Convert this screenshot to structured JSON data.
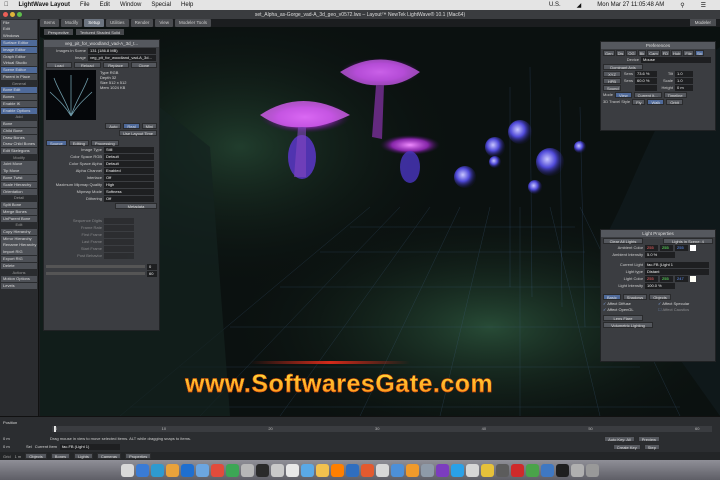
{
  "menubar": {
    "app_name": "LightWave Layout",
    "items": [
      "File",
      "Edit",
      "Window",
      "Special",
      "Help"
    ],
    "clock": "Mon Mar 27 11:05:48 AM",
    "locale": "U.S."
  },
  "window": {
    "title": "set_Alpha_as-Gorge_vad-A_3d_geo_v0572.lws – Layout™ NewTek LightWave® 10.1 (Mac64)"
  },
  "layout_tabs": [
    {
      "label": "Items",
      "active": false
    },
    {
      "label": "Modify",
      "active": false
    },
    {
      "label": "Setup",
      "active": true
    },
    {
      "label": "Utilities",
      "active": false
    },
    {
      "label": "Render",
      "active": false
    },
    {
      "label": "View",
      "active": false
    },
    {
      "label": "Modeler Tools",
      "active": false
    }
  ],
  "modeler_button": "Modeler",
  "sidebar": {
    "items": [
      {
        "label": "File",
        "type": "item"
      },
      {
        "label": "Edit",
        "type": "item"
      },
      {
        "label": "Windows",
        "type": "item"
      },
      {
        "label": "Surface Editor",
        "type": "hl"
      },
      {
        "label": "Image Editor",
        "type": "hl"
      },
      {
        "label": "Graph Editor",
        "type": "item"
      },
      {
        "label": "Virtual Studio",
        "type": "item"
      },
      {
        "label": "Scene Editor",
        "type": "hl"
      },
      {
        "label": "Parent in Place",
        "type": "item"
      },
      {
        "label": "General",
        "type": "head"
      },
      {
        "label": "Bone Edit",
        "type": "hl"
      },
      {
        "label": "Bones",
        "type": "item"
      },
      {
        "label": "Enable IK",
        "type": "item"
      },
      {
        "label": "Enable Options",
        "type": "hl"
      },
      {
        "label": "Add",
        "type": "head"
      },
      {
        "label": "Bone",
        "type": "item"
      },
      {
        "label": "Child Bone",
        "type": "item"
      },
      {
        "label": "Draw Bones",
        "type": "item"
      },
      {
        "label": "Draw Child Bones",
        "type": "item"
      },
      {
        "label": "Edit Skelegons",
        "type": "item"
      },
      {
        "label": "Modify",
        "type": "head"
      },
      {
        "label": "Joint Move",
        "type": "item"
      },
      {
        "label": "Tip Move",
        "type": "item"
      },
      {
        "label": "Bone Twist",
        "type": "item"
      },
      {
        "label": "Scale Hierarchy",
        "type": "item"
      },
      {
        "label": "Orientation",
        "type": "item"
      },
      {
        "label": "Detail",
        "type": "head"
      },
      {
        "label": "Split Bone",
        "type": "item"
      },
      {
        "label": "Merge Bones",
        "type": "item"
      },
      {
        "label": "UnParent Bone",
        "type": "item"
      },
      {
        "label": "Edit",
        "type": "head"
      },
      {
        "label": "Copy Hierarchy",
        "type": "item"
      },
      {
        "label": "Mirror Hierarchy",
        "type": "item"
      },
      {
        "label": "Rename Hierarchy",
        "type": "item"
      },
      {
        "label": "Import RIG",
        "type": "item"
      },
      {
        "label": "Export RIG",
        "type": "item"
      },
      {
        "label": "Delete",
        "type": "item"
      },
      {
        "label": "Actions",
        "type": "head"
      },
      {
        "label": "Motion Options",
        "type": "item"
      },
      {
        "label": "Levels",
        "type": "item"
      }
    ]
  },
  "viewport": {
    "view_mode": "Perspective",
    "shading": "Textured Shaded Solid"
  },
  "image_editor": {
    "title": "veg_pit_for_woodland_vad-A_3d_t...",
    "images_in_scene_label": "Images in Scene",
    "images_in_scene_value": "131 (186.8 MB)",
    "image_label": "Image",
    "image_value": "veg_pit_for_woodland_vad-A_3d...",
    "buttons": [
      "Load",
      "Reload",
      "Replace",
      "Clone"
    ],
    "info": [
      {
        "k": "Type",
        "v": "RGB"
      },
      {
        "k": "Depth",
        "v": "32"
      },
      {
        "k": "Size",
        "v": "512 x 512"
      },
      {
        "k": "Mem",
        "v": "1024 KB"
      }
    ],
    "view_buttons": [
      "Auto",
      "Real",
      "Mini"
    ],
    "use_layout_time": "Use Layout Time",
    "tabs": [
      "Source",
      "Editing",
      "Processing"
    ],
    "fields": [
      {
        "k": "Image Type",
        "v": "Still"
      },
      {
        "k": "Color Space RGB",
        "v": "Default"
      },
      {
        "k": "Color Space Alpha",
        "v": "Default"
      },
      {
        "k": "Alpha Channel",
        "v": "Enabled"
      },
      {
        "k": "Interlace",
        "v": "Off"
      },
      {
        "k": "Maximum Mipmap Quality",
        "v": "High"
      },
      {
        "k": "Mipmap Mode",
        "v": "Softness"
      },
      {
        "k": "Dithering",
        "v": "Off"
      }
    ],
    "metadata_button": "Metadata",
    "sequence_fields": [
      "Sequence Digits",
      "Frame Rate",
      "First Frame",
      "Last Frame",
      "Start Frame",
      "Post Behavior"
    ],
    "field_values": [
      "0",
      "60"
    ]
  },
  "preferences": {
    "title": "Preferences",
    "tabs": [
      "Gen",
      "Dis",
      "OG",
      "Bk",
      "Cam",
      "FD",
      "Hub",
      "File",
      "Ski"
    ],
    "device_label": "Device",
    "device_value": "Mouse",
    "dominant_axis": "Dominant Axis",
    "rows": [
      {
        "k": "XYZ",
        "v1": "Sens",
        "v2": "73.6 %",
        "v3": "Tilt",
        "v4": "1.0"
      },
      {
        "k": "HPB",
        "v1": "Sens",
        "v2": "60.0 %",
        "v3": "Scale",
        "v4": "1.0"
      },
      {
        "k": "Sound",
        "v1": "",
        "v2": "",
        "v3": "Height",
        "v4": "0 m"
      }
    ],
    "mode_row": [
      "Mode",
      "View",
      "Current It...",
      "Timeline"
    ],
    "travel_row": [
      "3D Travel Style",
      "Fly",
      "Walk",
      "Orbit"
    ]
  },
  "light_properties": {
    "title": "Light Properties",
    "clear_lights": "Clear All Lights",
    "lights_in_scene": "Lights in Scene: 4",
    "ambient_color_label": "Ambient Color",
    "ambient_color_rgb": [
      "255",
      "255",
      "255"
    ],
    "ambient_intensity_label": "Ambient Intensity",
    "ambient_intensity": "5.0 %",
    "current_light_label": "Current Light",
    "current_light": "fac.FB (Light 1",
    "light_type_label": "Light type",
    "light_type": "Distant",
    "light_color_label": "Light Color",
    "light_color_rgb": [
      "255",
      "255",
      "247"
    ],
    "light_intensity_label": "Light Intensity",
    "light_intensity": "100.0 %",
    "tabs": [
      "Basic",
      "Shadows",
      "Objects"
    ],
    "checks": [
      {
        "label": "Affect Diffuse",
        "checked": true
      },
      {
        "label": "Affect Specular",
        "checked": true
      },
      {
        "label": "Affect OpenGL",
        "checked": true
      },
      {
        "label": "Affect Caustics",
        "checked": false
      }
    ],
    "lens_flare": "Lens Flare",
    "volumetric": "Volumetric Lighting"
  },
  "watermark": "www.SoftwaresGate.com",
  "timeline": {
    "position_label": "Position",
    "ticks": [
      "0",
      "10",
      "20",
      "30",
      "40",
      "50",
      "60"
    ],
    "status_hint": "Drag mouse in view to move selected items. ALT while dragging snaps to items.",
    "auto_key": "Auto Key: All",
    "create_key": "Create Key",
    "delete_key": "Delete Key",
    "current_item_label": "Current Item",
    "current_item": "fac.FB (Light 1)",
    "preview": "Preview",
    "step": "Step",
    "sel_label": "Sel",
    "rows": [
      "0 m",
      "0 m",
      "0 m"
    ]
  },
  "bottom_bar": {
    "items": [
      "Objects",
      "Bones",
      "Lights",
      "Cameras",
      "Properties"
    ],
    "grid_label": "Grid",
    "grid_value": "1 m"
  },
  "dock": {
    "icon_colors": [
      "#d9d9d9",
      "#3a7bd5",
      "#2e9ad0",
      "#e9a23b",
      "#1f6fd0",
      "#6ca6e0",
      "#e24b3b",
      "#3ca655",
      "#b7b7b7",
      "#2a2a2a",
      "#c9c9c9",
      "#e8e8e8",
      "#5aa9e6",
      "#f2c14e",
      "#ff7f00",
      "#2f6ebf",
      "#e35a2f",
      "#d8d8d8",
      "#4d90d8",
      "#f09a2b",
      "#8e9aa8",
      "#7c3cbf",
      "#2aa1e8",
      "#d6d6d6",
      "#e6c13a",
      "#5c5c5c",
      "#cf2a2a",
      "#4aa34a",
      "#3f78c2",
      "#1f1f1f",
      "#b0b0b0",
      "#999999"
    ]
  }
}
